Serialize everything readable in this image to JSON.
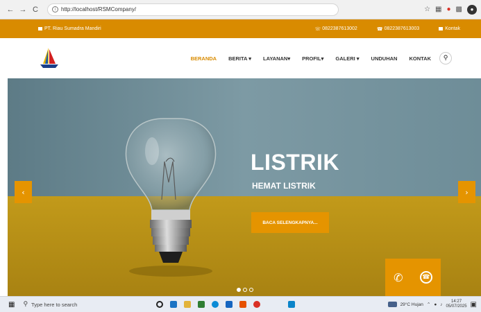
{
  "browser": {
    "url": "http://localhost/RSMCompany/",
    "back_icon": "arrow-left-icon",
    "forward_icon": "arrow-right-icon",
    "reload_icon": "reload-icon"
  },
  "topbar": {
    "company": "PT. Riau Sumadra Mandiri",
    "phone1": "0822387613002",
    "phone2": "0822387613003",
    "contact_label": "Kontak",
    "background": "#d98b00"
  },
  "nav": {
    "items": [
      {
        "label": "BERANDA",
        "active": true
      },
      {
        "label": "BERITA ▾",
        "active": false
      },
      {
        "label": "LAYANAN▾",
        "active": false
      },
      {
        "label": "PROFIL▾",
        "active": false
      },
      {
        "label": "GALERI ▾",
        "active": false
      },
      {
        "label": "UNDUHAN",
        "active": false
      },
      {
        "label": "KONTAK",
        "active": false
      }
    ]
  },
  "hero": {
    "title": "LISTRIK",
    "subtitle": "HEMAT LISTRIK",
    "cta": "BACA SELENGKAPNYA...",
    "prev": "‹",
    "next": "›",
    "slides": 3,
    "active_slide": 1,
    "accent": "#e59400"
  },
  "taskbar": {
    "search_placeholder": "Type here to search",
    "weather": "29°C Hujan",
    "time": "14:27",
    "date": "05/07/2025"
  }
}
